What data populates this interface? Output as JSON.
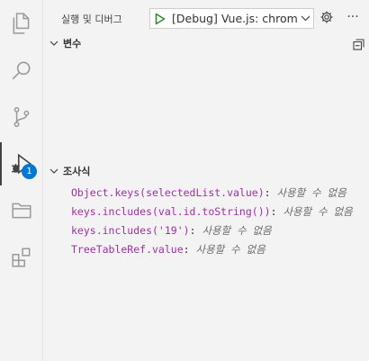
{
  "panel": {
    "title": "실행 및 디버그",
    "launch_config": "[Debug] Vue.js: chrome",
    "more_label": "···"
  },
  "activity": {
    "debug_badge": "1"
  },
  "sections": {
    "variables": "변수",
    "watch": "조사식"
  },
  "watch_items": [
    {
      "expression": "Object.keys(selectedList.value)",
      "separator": ":",
      "value": "사용할 수 없음"
    },
    {
      "expression": "keys.includes(val.id.toString())",
      "separator": ":",
      "value": "사용할 수 없음"
    },
    {
      "expression": "keys.includes('19')",
      "separator": ":",
      "value": "사용할 수 없음"
    },
    {
      "expression": "TreeTableRef.value",
      "separator": ":",
      "value": "사용할 수 없음"
    }
  ],
  "colors": {
    "expression": "#a02fa8",
    "accent": "#0078d4",
    "play": "#388a34"
  }
}
